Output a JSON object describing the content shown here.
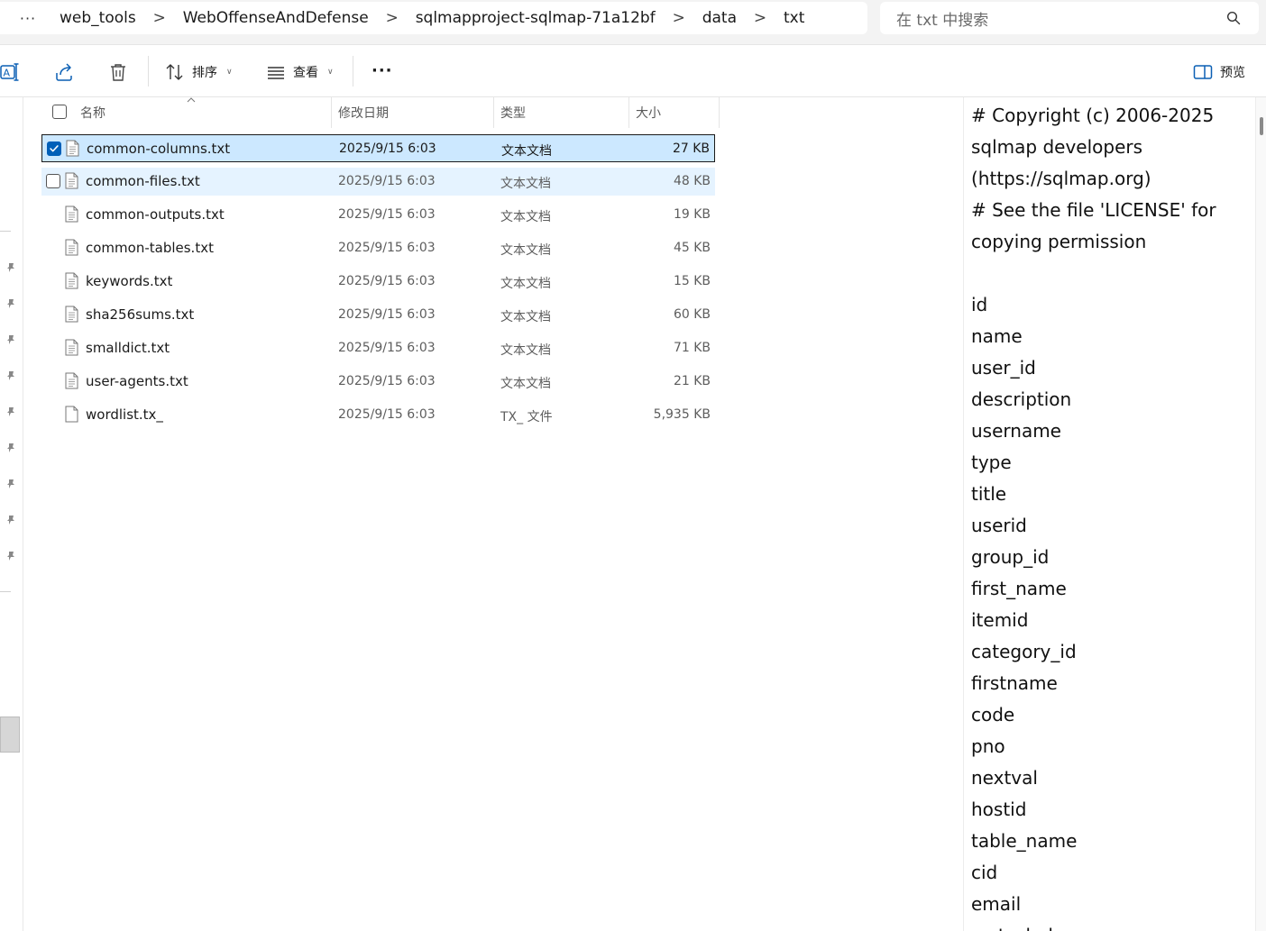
{
  "address_bar": {
    "more": "···",
    "breadcrumb": [
      "web_tools",
      "WebOffenseAndDefense",
      "sqlmapproject-sqlmap-71a12bf",
      "data",
      "txt"
    ],
    "separator": ">"
  },
  "search": {
    "placeholder": "在 txt 中搜索",
    "icon": "search-icon"
  },
  "toolbar": {
    "sort_label": "排序",
    "view_label": "查看",
    "more_label": "···",
    "preview_label": "预览"
  },
  "columns": {
    "name": "名称",
    "date": "修改日期",
    "type": "类型",
    "size": "大小"
  },
  "files": [
    {
      "name": "common-columns.txt",
      "date": "2025/9/15 6:03",
      "type": "文本文档",
      "size": "27 KB",
      "selected": true
    },
    {
      "name": "common-files.txt",
      "date": "2025/9/15 6:03",
      "type": "文本文档",
      "size": "48 KB",
      "hover": true
    },
    {
      "name": "common-outputs.txt",
      "date": "2025/9/15 6:03",
      "type": "文本文档",
      "size": "19 KB"
    },
    {
      "name": "common-tables.txt",
      "date": "2025/9/15 6:03",
      "type": "文本文档",
      "size": "45 KB"
    },
    {
      "name": "keywords.txt",
      "date": "2025/9/15 6:03",
      "type": "文本文档",
      "size": "15 KB"
    },
    {
      "name": "sha256sums.txt",
      "date": "2025/9/15 6:03",
      "type": "文本文档",
      "size": "60 KB"
    },
    {
      "name": "smalldict.txt",
      "date": "2025/9/15 6:03",
      "type": "文本文档",
      "size": "71 KB"
    },
    {
      "name": "user-agents.txt",
      "date": "2025/9/15 6:03",
      "type": "文本文档",
      "size": "21 KB"
    },
    {
      "name": "wordlist.tx_",
      "date": "2025/9/15 6:03",
      "type": "TX_ 文件",
      "size": "5,935 KB"
    }
  ],
  "preview": {
    "lines": [
      "# Copyright (c) 2006-2025",
      "sqlmap developers",
      "(https://sqlmap.org)",
      "# See the file 'LICENSE' for",
      "copying permission",
      "",
      "id",
      "name",
      "user_id",
      "description",
      "username",
      "type",
      "title",
      "userid",
      "group_id",
      "first_name",
      "itemid",
      "category_id",
      "firstname",
      "code",
      "pno",
      "nextval",
      "hostid",
      "table_name",
      "cid",
      "email",
      "smtp_helo"
    ]
  },
  "colors": {
    "accent": "#005fb8",
    "selection": "#cce8ff",
    "hover": "#e5f3ff"
  }
}
